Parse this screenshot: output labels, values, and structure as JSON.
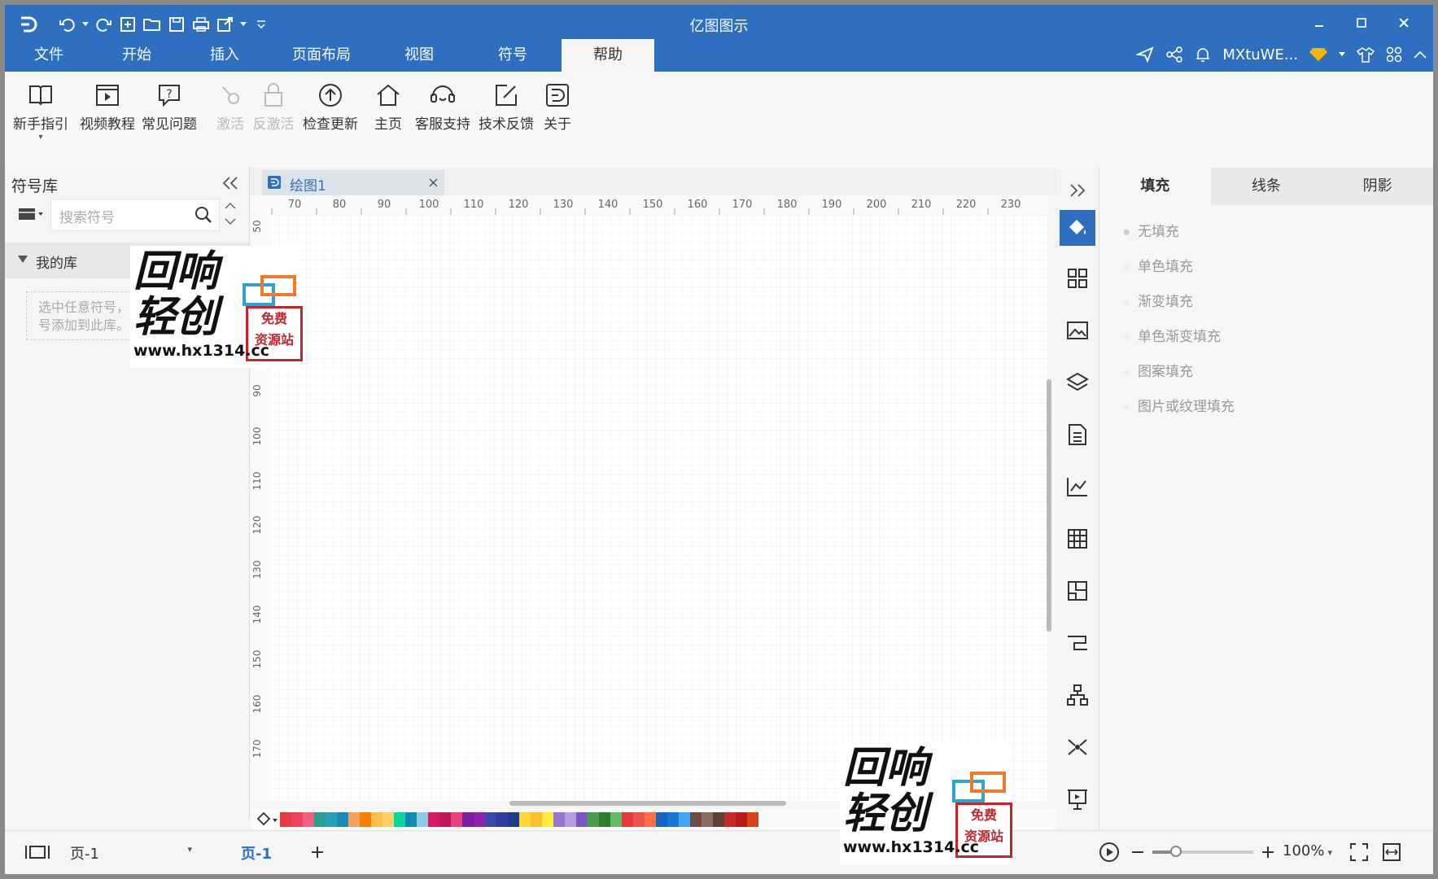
{
  "app": {
    "title": "亿图图示",
    "user": "MXtuWE..."
  },
  "menu": {
    "tabs": [
      "文件",
      "开始",
      "插入",
      "页面布局",
      "视图",
      "符号",
      "帮助"
    ],
    "active_tab": "帮助"
  },
  "ribbon": {
    "buttons": [
      {
        "label": "新手指引",
        "icon": "book-icon",
        "enabled": true
      },
      {
        "label": "视频教程",
        "icon": "video-icon",
        "enabled": true
      },
      {
        "label": "常见问题",
        "icon": "question-icon",
        "enabled": true
      },
      {
        "label": "激活",
        "icon": "key-icon",
        "enabled": false
      },
      {
        "label": "反激活",
        "icon": "lock-icon",
        "enabled": false
      },
      {
        "label": "检查更新",
        "icon": "upload-circle-icon",
        "enabled": true
      },
      {
        "label": "主页",
        "icon": "home-icon",
        "enabled": true
      },
      {
        "label": "客服支持",
        "icon": "headset-icon",
        "enabled": true
      },
      {
        "label": "技术反馈",
        "icon": "edit-icon",
        "enabled": true
      },
      {
        "label": "关于",
        "icon": "logo-icon",
        "enabled": true
      }
    ]
  },
  "left_panel": {
    "title": "符号库",
    "search_placeholder": "搜索符号",
    "my_library": "我的库",
    "hint_line1": "选中任意符号，",
    "hint_line2": "号添加到此库。"
  },
  "document": {
    "tab_name": "绘图1"
  },
  "rulers": {
    "horizontal": [
      "70",
      "80",
      "90",
      "100",
      "110",
      "120",
      "130",
      "140",
      "150",
      "160",
      "170",
      "180",
      "190",
      "200",
      "210",
      "220",
      "230"
    ],
    "vertical": [
      "50",
      "90",
      "100",
      "110",
      "120",
      "130",
      "140",
      "150",
      "160",
      "170"
    ]
  },
  "right_panel": {
    "tabs": [
      "填充",
      "线条",
      "阴影"
    ],
    "active_tab": "填充",
    "fill_options": [
      "无填充",
      "单色填充",
      "渐变填充",
      "单色渐变填充",
      "图案填充",
      "图片或纹理填充"
    ]
  },
  "status": {
    "page_selector": "页-1",
    "page_tab": "页-1",
    "zoom": "100%"
  },
  "watermark": {
    "line1": "回响",
    "line2": "轻创",
    "url": "www.hx1314.cc",
    "stamp1": "免费",
    "stamp2": "资源站"
  },
  "palette_colors": [
    "#e63946",
    "#e9445a",
    "#f06080",
    "#2a9d8f",
    "#26a0b5",
    "#1e88b9",
    "#f4a261",
    "#f77f00",
    "#fcbf49",
    "#ffd166",
    "#06d6a0",
    "#118ab2",
    "#8ecae6",
    "#d81b60",
    "#c2185b",
    "#ec407a",
    "#7b1fa2",
    "#8e24aa",
    "#3949ab",
    "#303f9f",
    "#1e3a8a",
    "#fdd835",
    "#fbc02d",
    "#ffeb3b",
    "#9575cd",
    "#b39ddb",
    "#7e57c2",
    "#43a047",
    "#2e7d32",
    "#66bb6a",
    "#e53935",
    "#ef5350",
    "#ff7043",
    "#1565c0",
    "#1976d2",
    "#42a5f5",
    "#6d4c41",
    "#8d6e63",
    "#5d4037",
    "#c62828",
    "#b71c1c",
    "#d84315"
  ],
  "colors": {
    "accent": "#2f6fc0"
  }
}
